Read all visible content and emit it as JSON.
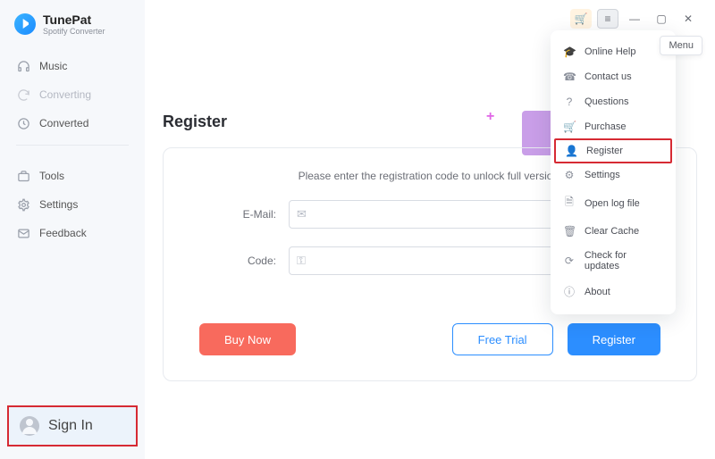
{
  "brand": {
    "title": "TunePat",
    "subtitle": "Spotify Converter"
  },
  "sidebar": {
    "items": [
      {
        "label": "Music"
      },
      {
        "label": "Converting"
      },
      {
        "label": "Converted"
      },
      {
        "label": "Tools"
      },
      {
        "label": "Settings"
      },
      {
        "label": "Feedback"
      }
    ],
    "signin_label": "Sign In"
  },
  "tooltip": {
    "menu": "Menu"
  },
  "dropdown": {
    "items": [
      {
        "label": "Online Help"
      },
      {
        "label": "Contact us"
      },
      {
        "label": "Questions"
      },
      {
        "label": "Purchase"
      },
      {
        "label": "Register"
      },
      {
        "label": "Settings"
      },
      {
        "label": "Open log file"
      },
      {
        "label": "Clear Cache"
      },
      {
        "label": "Check for updates"
      },
      {
        "label": "About"
      }
    ]
  },
  "page": {
    "title": "Register",
    "hint": "Please enter the registration code to unlock full version.",
    "email_label": "E-Mail:",
    "code_label": "Code:",
    "email_value": "",
    "code_value": "",
    "buy_label": "Buy Now",
    "trial_label": "Free Trial",
    "register_label": "Register"
  }
}
